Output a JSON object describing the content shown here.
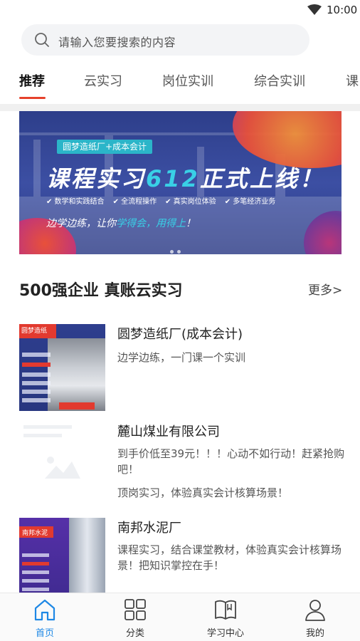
{
  "status_bar": {
    "time": "10:00"
  },
  "search": {
    "placeholder": "请输入您要搜索的内容"
  },
  "tabs": [
    {
      "label": "推荐",
      "active": true
    },
    {
      "label": "云实习"
    },
    {
      "label": "岗位实训"
    },
    {
      "label": "综合实训"
    },
    {
      "label": "课"
    }
  ],
  "banner": {
    "tag": "圆梦造纸厂+成本会计",
    "headline_a": "课程实习",
    "headline_b": "612",
    "headline_c": "正式上线！",
    "features": [
      "✔ 数学和实践结合",
      "✔ 全流程操作",
      "✔ 真实岗位体验",
      "✔ 多笔经济业务"
    ],
    "slogan_a": "边学边练，让你",
    "slogan_b": "学得会，用得上",
    "slogan_c": "！"
  },
  "section": {
    "title": "500强企业 真账云实习",
    "more": "更多>"
  },
  "courses": [
    {
      "title": "圆梦造纸厂(成本会计)",
      "desc": [
        "边学边练，一门课一个实训"
      ],
      "thumb_text": "圆梦造纸"
    },
    {
      "title": "麓山煤业有限公司",
      "desc": [
        "到手价低至39元！！！心动不如行动！赶紧抢购吧！",
        "顶岗实习，体验真实会计核算场景！"
      ]
    },
    {
      "title": "南邦水泥厂",
      "desc": [
        "课程实习，结合课堂教材，体验真实会计核算场景！把知识掌控在手！"
      ],
      "thumb_text": "南邦水泥"
    }
  ],
  "bottom_nav": [
    {
      "label": "首页",
      "icon": "home-icon",
      "active": true
    },
    {
      "label": "分类",
      "icon": "grid-icon"
    },
    {
      "label": "学习中心",
      "icon": "book-icon"
    },
    {
      "label": "我的",
      "icon": "user-icon"
    }
  ],
  "colors": {
    "accent": "#e6412b",
    "nav_active": "#1e88e5",
    "banner_cyan": "#39d0e6"
  }
}
